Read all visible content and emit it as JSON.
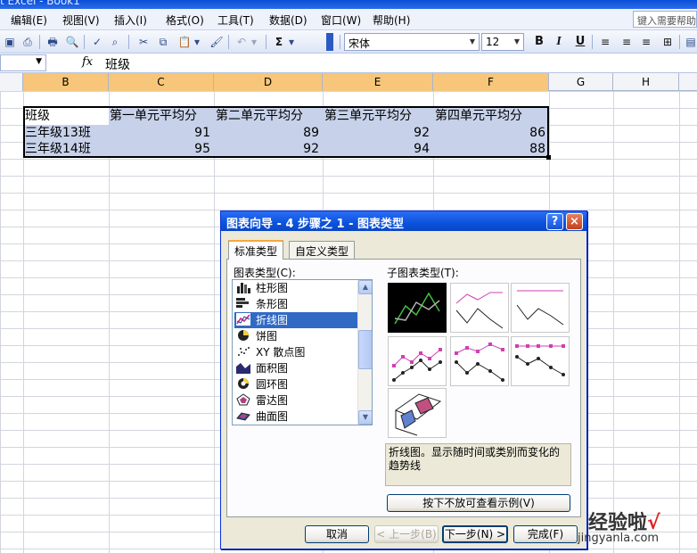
{
  "app": {
    "title_fragment": "t Excel - Book1"
  },
  "menu": {
    "items": [
      "编辑(E)",
      "视图(V)",
      "插入(I)",
      "格式(O)",
      "工具(T)",
      "数据(D)",
      "窗口(W)",
      "帮助(H)"
    ],
    "help_placeholder": "键入需要帮助"
  },
  "toolbar": {
    "font_name": "宋体",
    "font_size": "12",
    "bold": "B",
    "italic": "I",
    "underline": "U",
    "sum": "Σ"
  },
  "formula_bar": {
    "fx": "fx",
    "content": "班级"
  },
  "columns": [
    "B",
    "C",
    "D",
    "E",
    "F",
    "G",
    "H"
  ],
  "sheet": {
    "headers": [
      "班级",
      "第一单元平均分",
      "第二单元平均分",
      "第三单元平均分",
      "第四单元平均分"
    ],
    "rows": [
      {
        "name": "三年级13班",
        "v1": "91",
        "v2": "89",
        "v3": "92",
        "v4": "86"
      },
      {
        "name": "三年级14班",
        "v1": "95",
        "v2": "92",
        "v3": "94",
        "v4": "88"
      }
    ]
  },
  "dialog": {
    "title": "图表向导 - 4 步骤之 1 - 图表类型",
    "help": "?",
    "close": "×",
    "tabs": [
      "标准类型",
      "自定义类型"
    ],
    "chart_type_label": "图表类型(C):",
    "subtype_label": "子图表类型(T):",
    "chart_types": [
      "柱形图",
      "条形图",
      "折线图",
      "饼图",
      "XY 散点图",
      "面积图",
      "圆环图",
      "雷达图",
      "曲面图"
    ],
    "selected_type": "折线图",
    "description": "折线图。显示随时间或类别而变化的趋势线",
    "preview_button": "按下不放可查看示例(V)",
    "buttons": {
      "cancel": "取消",
      "back": "< 上一步(B)",
      "next": "下一步(N) >",
      "finish": "完成(F)"
    }
  },
  "watermark": {
    "main": "经验啦",
    "check": "√",
    "sub": "jingyanla.com"
  },
  "colors": {
    "selection": "#c7d2ea",
    "list_highlight": "#316ac5",
    "title_bar": "#0b52dc",
    "selected_col_header": "#f7c67a"
  }
}
